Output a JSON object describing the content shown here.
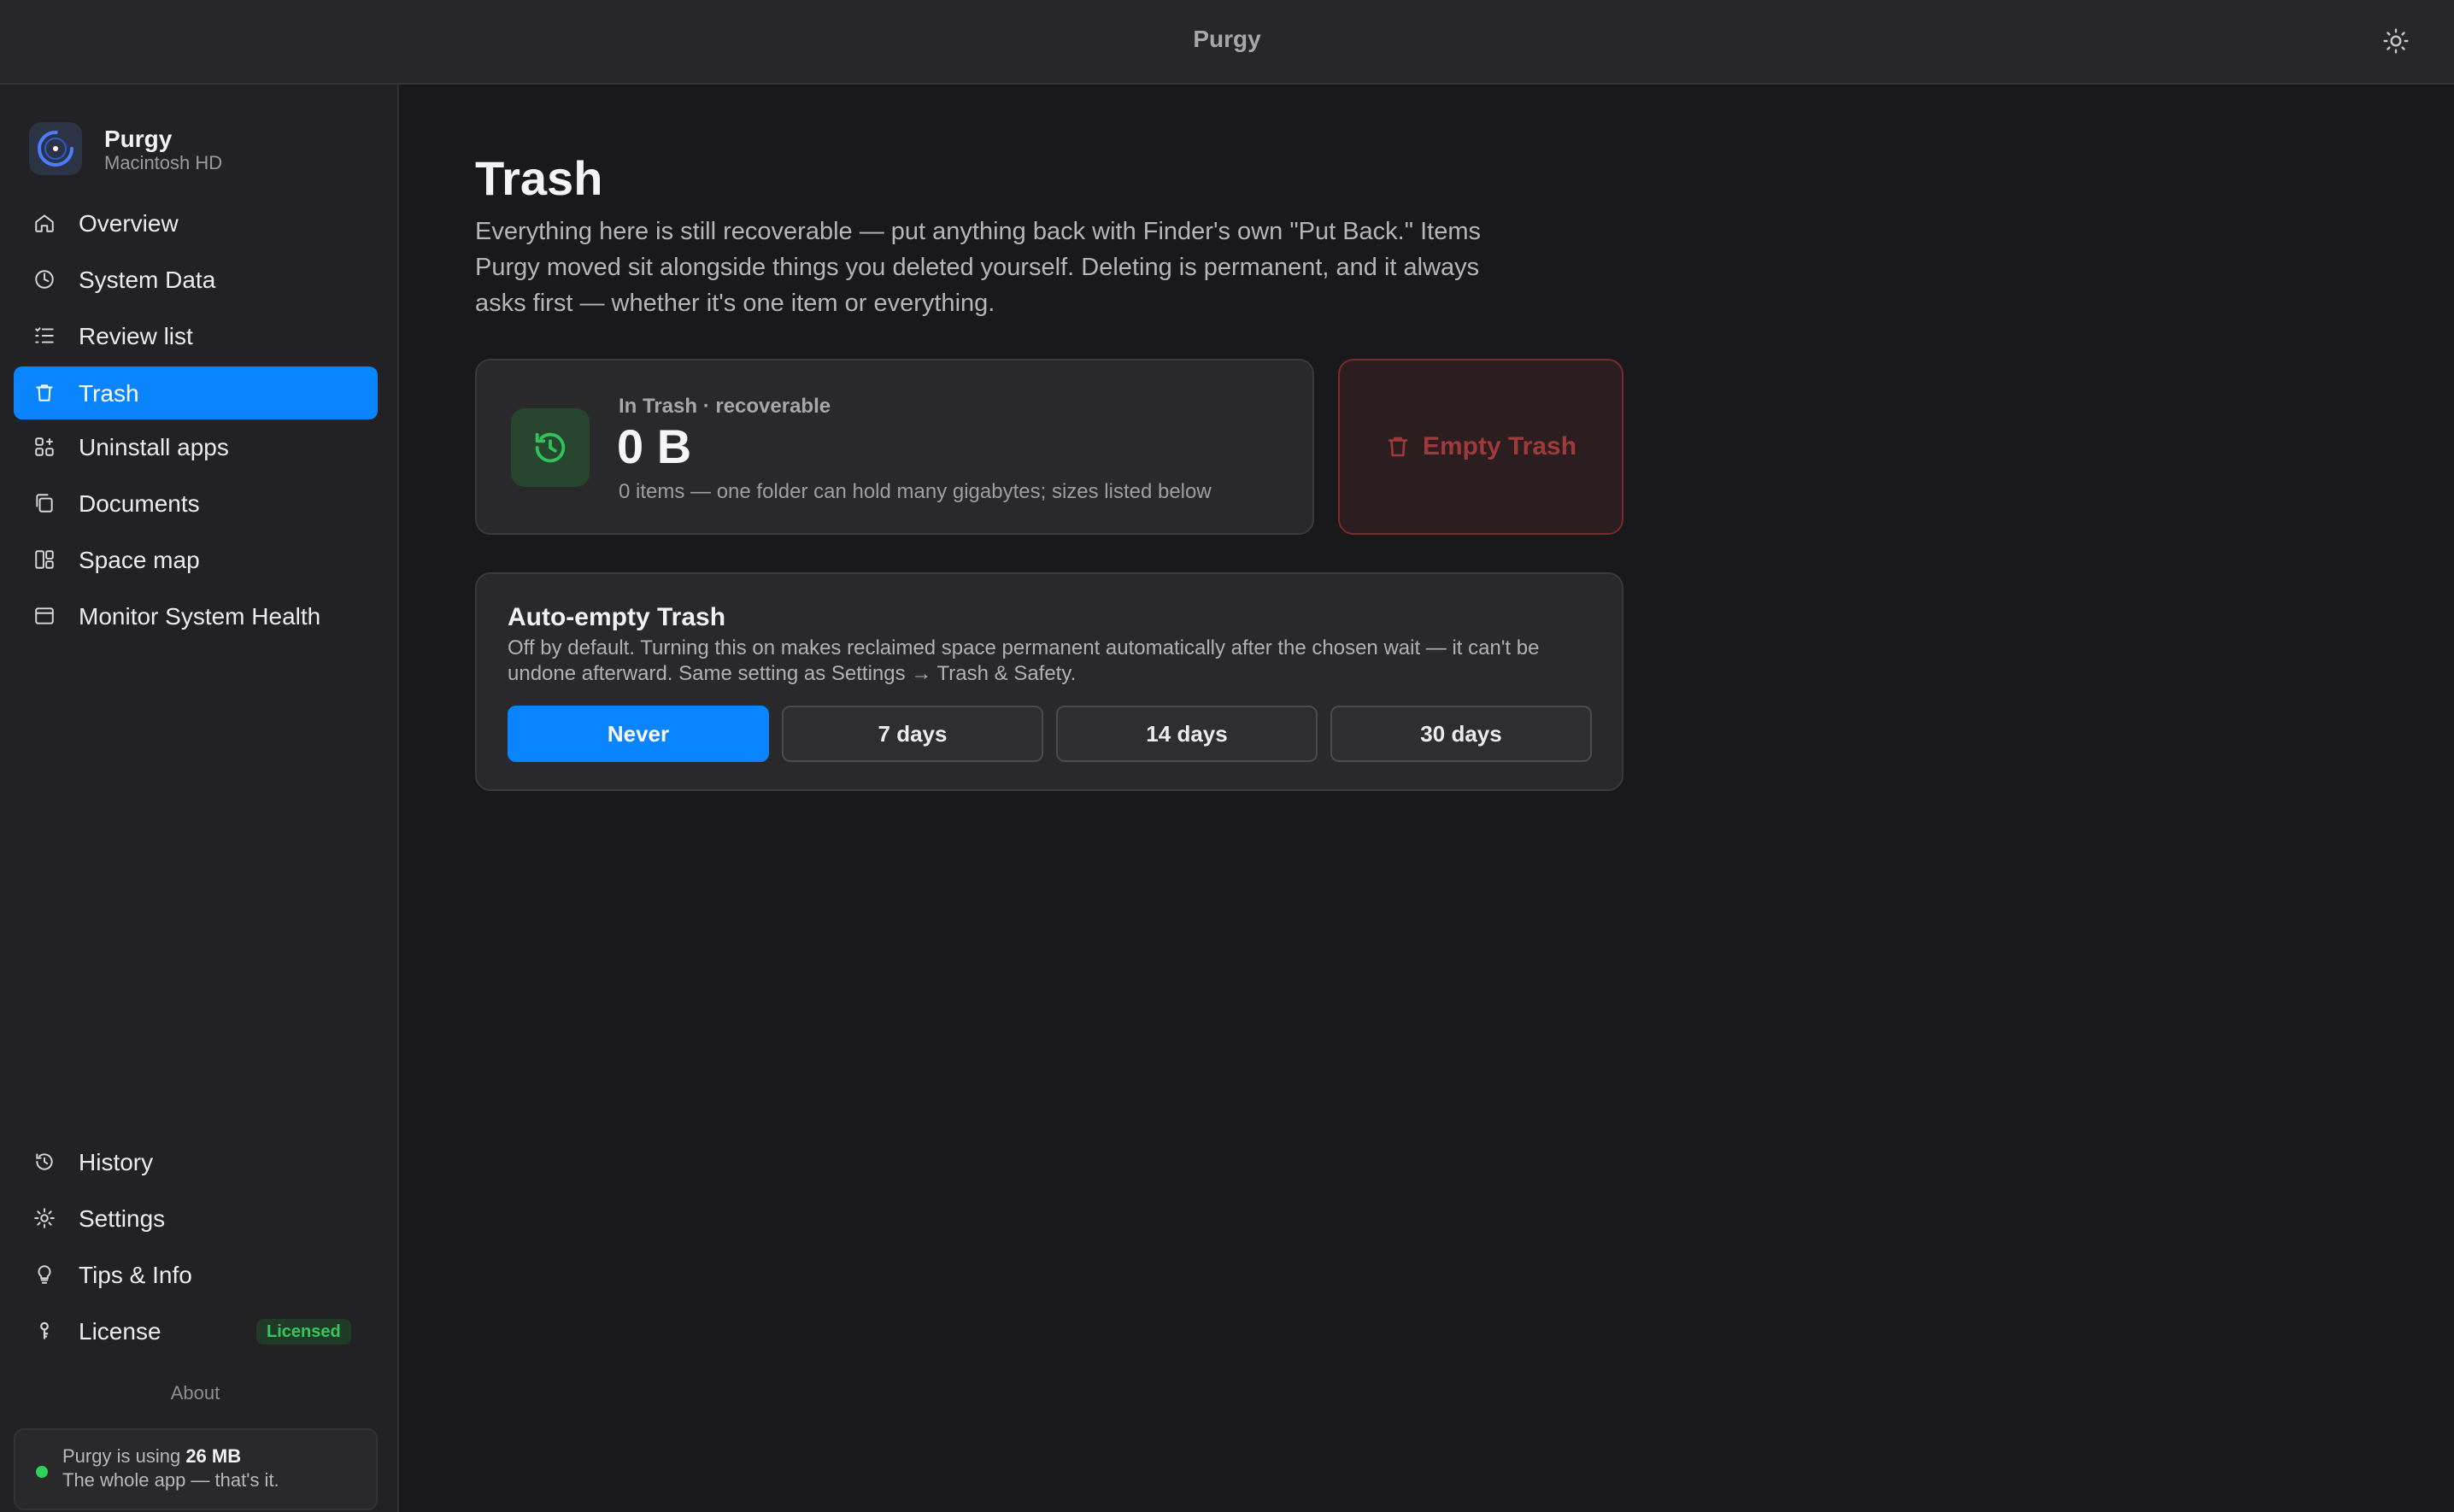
{
  "window": {
    "title": "Purgy",
    "theme_icon": "sun-icon"
  },
  "sidebar": {
    "brand": {
      "name": "Purgy",
      "volume": "Macintosh HD"
    },
    "items": [
      {
        "label": "Overview",
        "icon": "home-icon"
      },
      {
        "label": "System Data",
        "icon": "clock-pie-icon"
      },
      {
        "label": "Review list",
        "icon": "list-checks-icon"
      },
      {
        "label": "Trash",
        "icon": "trash-icon",
        "active": true
      },
      {
        "label": "Uninstall apps",
        "icon": "apps-grid-icon"
      },
      {
        "label": "Documents",
        "icon": "documents-icon"
      },
      {
        "label": "Space map",
        "icon": "space-map-icon"
      },
      {
        "label": "Monitor System Health",
        "icon": "window-icon"
      }
    ],
    "bottom_items": [
      {
        "label": "History",
        "icon": "history-icon"
      },
      {
        "label": "Settings",
        "icon": "gear-icon"
      },
      {
        "label": "Tips & Info",
        "icon": "lightbulb-icon"
      },
      {
        "label": "License",
        "icon": "key-icon",
        "badge": "Licensed"
      }
    ],
    "about": "About",
    "memory": {
      "prefix": "Purgy is using",
      "amount": "26 MB",
      "note": "The whole app — that's it."
    }
  },
  "main": {
    "title": "Trash",
    "description": "Everything here is still recoverable — put anything back with Finder's own \"Put Back.\" Items Purgy moved sit alongside things you deleted yourself. Deleting is permanent, and it always asks first — whether it's one item or everything.",
    "stat": {
      "label": "In Trash · recoverable",
      "value": "0 B",
      "note": "0 items — one folder can hold many gigabytes; sizes listed below"
    },
    "empty_button": "Empty Trash",
    "auto_empty": {
      "title": "Auto-empty Trash",
      "description": "Off by default. Turning this on makes reclaimed space permanent automatically after the chosen wait — it can't be undone afterward. Same setting as Settings → Trash & Safety.",
      "options": [
        "Never",
        "7 days",
        "14 days",
        "30 days"
      ],
      "selected": "Never"
    }
  },
  "colors": {
    "accent": "#0a84ff",
    "success": "#30d158",
    "danger": "#a03a3a",
    "background": "#19191b",
    "sidebar": "#222224"
  }
}
